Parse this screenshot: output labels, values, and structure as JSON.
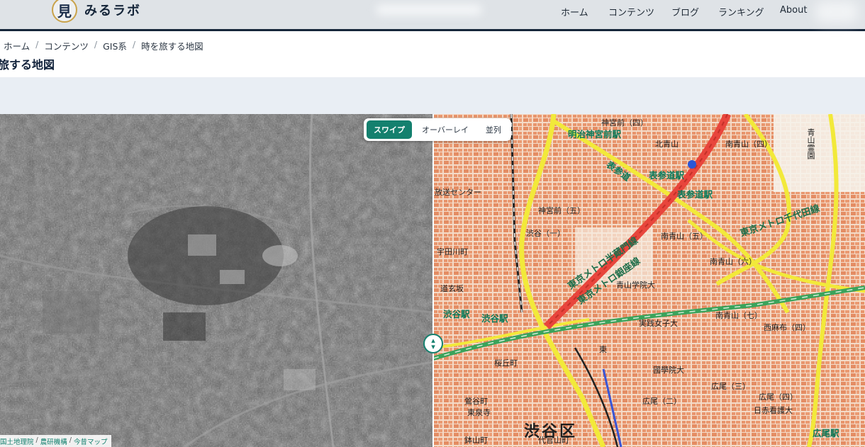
{
  "header": {
    "logo_mark": "見",
    "site_name": "みるラボ",
    "nav": [
      "ホーム",
      "コンテンツ",
      "ブログ",
      "ランキング",
      "About"
    ]
  },
  "breadcrumb": [
    "ホーム",
    "コンテンツ",
    "GIS系",
    "時を旅する地図"
  ],
  "page_title": "旅する地図",
  "map": {
    "modes": [
      "スワイプ",
      "オーバーレイ",
      "並列"
    ],
    "active_mode": "スワイプ",
    "attribution": [
      "国土地理院",
      "農研機構",
      "今昔マップ"
    ],
    "labels": {
      "ward": "渋谷区",
      "meiji_jingumae_station": "明治神宮前駅",
      "omotesando_station": "表参道駅",
      "shibuya_station": "渋谷駅",
      "hiroo_station": "広尾駅",
      "kitaaoyama": "北青山",
      "minamiaoyama_4": "南青山（四）",
      "minamiaoyama_5": "南青山（五）",
      "minamiaoyama_6": "南青山（六）",
      "minamiaoyama_7": "南青山（七）",
      "nishiazabu_4": "西麻布（四）",
      "jingumae_5": "神宮前（五）",
      "jingumae_4": "神宮前（四）",
      "omotesando": "表参道",
      "hanzomon_line": "東京メトロ半蔵門線",
      "ginza_line": "東京メトロ銀座線",
      "chiyoda_line": "東京メトロ千代田線",
      "aoyama_gakuin": "青山学院大",
      "jissen": "実践女子大",
      "kokugakuin": "國學院大",
      "hiroo_2": "広尾（二）",
      "hiroo_3": "広尾（三）",
      "hiroo_4": "広尾（四）",
      "nisseki": "日赤看護大",
      "aoyama_cemetery": "青山霊園",
      "udagawa": "宇田川町",
      "sakuragaoka": "桜丘町",
      "dogenzaka": "道玄坂",
      "uguisudani": "鶯谷町",
      "daikanyama": "代官山町",
      "hachiyama": "鉢山町",
      "shibuya_1": "渋谷（一）",
      "yoyogi_center": "放送センター",
      "toho": "東泉寺",
      "higashi": "東"
    }
  },
  "colors": {
    "accent": "#14806e",
    "header_border": "#16263a",
    "topo_bg": "#f3d9c6",
    "expressway": "#e8453c",
    "road_yellow": "#f2e93a",
    "jr_line": "#3aa35b"
  }
}
